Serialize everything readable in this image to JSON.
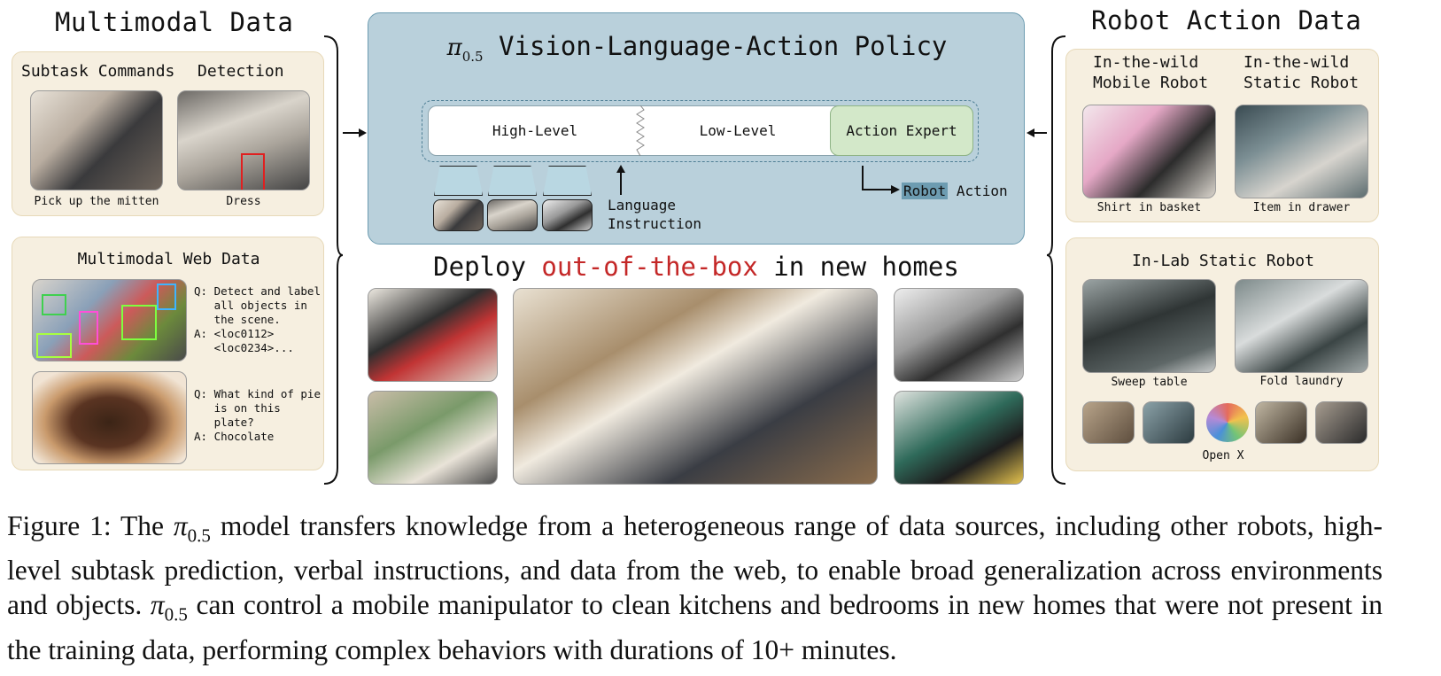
{
  "left": {
    "title": "Multimodal Data",
    "top_panel": {
      "subtask_heading": "Subtask Commands",
      "detection_heading": "Detection",
      "subtask_caption": "Pick up the mitten",
      "detection_caption": "Dress"
    },
    "web_panel": {
      "title": "Multimodal Web Data",
      "qa1": [
        "Q: Detect and label",
        "   all objects in",
        "   the scene.",
        "A: <loc0112>",
        "   <loc0234>..."
      ],
      "qa2": [
        "Q: What kind of pie",
        "   is on this",
        "   plate?",
        "A: Chocolate"
      ]
    }
  },
  "center": {
    "policy_symbol": "π",
    "policy_subscript": "0.5",
    "policy_title": "Vision-Language-Action Policy",
    "segments": {
      "high": "High-Level",
      "low": "Low-Level",
      "expert": "Action Expert"
    },
    "language_instruction": [
      "Language",
      "Instruction"
    ],
    "robot_word": "Robot",
    "action_word": "Action",
    "deploy_prefix": "Deploy ",
    "deploy_highlight": "out-of-the-box",
    "deploy_suffix": " in new homes"
  },
  "right": {
    "title": "Robot Action Data",
    "wild_panel": {
      "mobile_heading": [
        "In-the-wild",
        "Mobile Robot"
      ],
      "static_heading": [
        "In-the-wild",
        "Static Robot"
      ],
      "mobile_caption": "Shirt in basket",
      "static_caption": "Item in drawer"
    },
    "lab_panel": {
      "title": "In-Lab Static Robot",
      "sweep_caption": "Sweep table",
      "fold_caption": "Fold laundry",
      "openx_caption": "Open X"
    }
  },
  "caption": {
    "part1": "Figure 1: The ",
    "pi": "π",
    "sub": "0.5",
    "part2": " model transfers knowledge from a heterogeneous range of data sources, including other robots, high-level subtask prediction, verbal instructions, and data from the web, to enable broad generalization across environments and objects. ",
    "part3": " can control a mobile manipulator to clean kitchens and bedrooms in new homes that were not present in the training data, performing complex behaviors with durations of 10+ minutes."
  }
}
